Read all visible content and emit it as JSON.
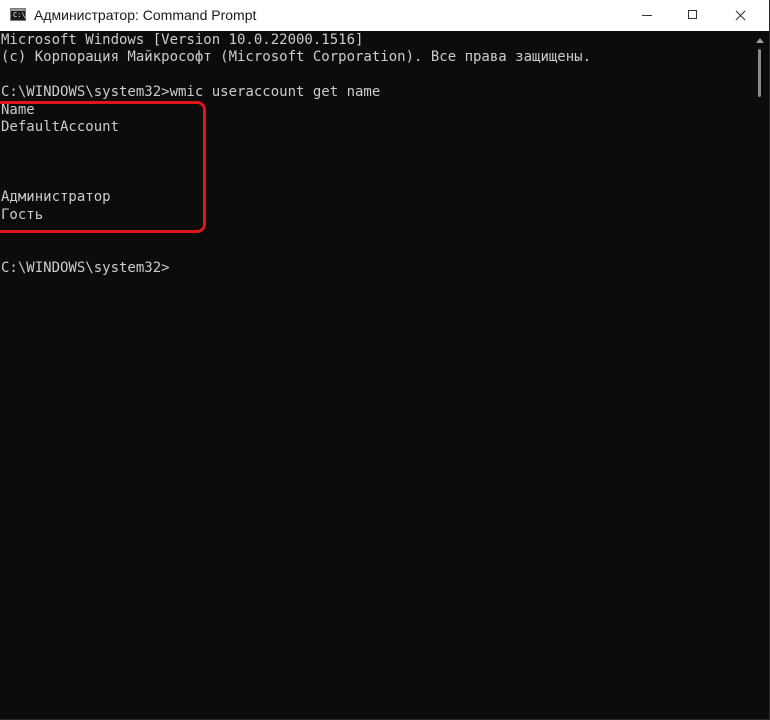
{
  "window": {
    "title": "Администратор: Command Prompt",
    "icon_label": "C:\\"
  },
  "console": {
    "lines": [
      "Microsoft Windows [Version 10.0.22000.1516]",
      "(c) Корпорация Майкрософт (Microsoft Corporation). Все права защищены.",
      "",
      "C:\\WINDOWS\\system32>wmic useraccount get name",
      "Name",
      "DefaultAccount",
      "",
      "",
      "",
      "Администратор",
      "Гость",
      "",
      "",
      "C:\\WINDOWS\\system32>"
    ]
  },
  "colors": {
    "terminal_background": "#0c0c0c",
    "terminal_text": "#cccccc",
    "highlight": "#e0161b"
  },
  "icons": {
    "app": "cmd-icon",
    "minimize": "minimize-icon",
    "maximize": "maximize-icon",
    "close": "close-icon"
  }
}
